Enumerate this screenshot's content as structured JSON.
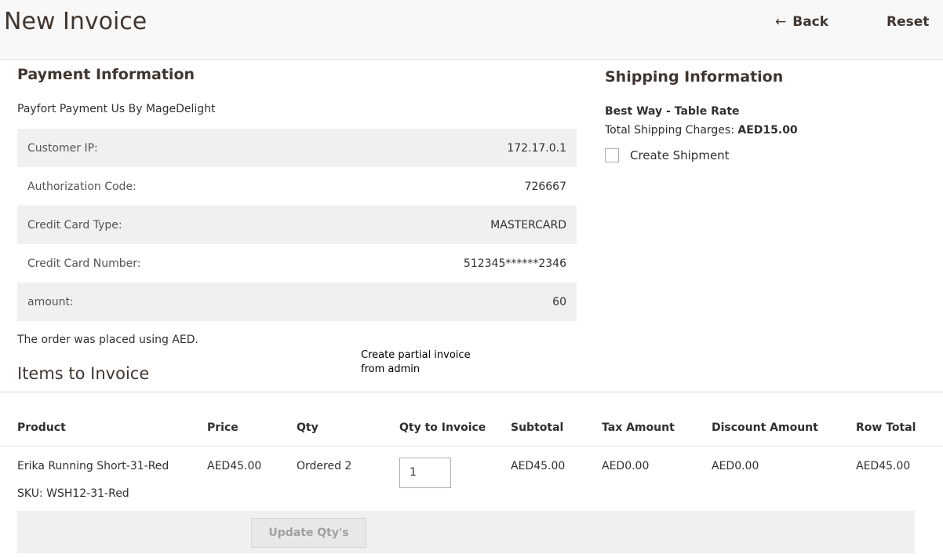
{
  "header": {
    "title": "New Invoice",
    "back_label": "Back",
    "back_arrow": "←",
    "reset_label": "Reset"
  },
  "payment": {
    "title": "Payment Information",
    "method": "Payfort Payment Us By MageDelight",
    "rows": [
      {
        "label": "Customer IP:",
        "value": "172.17.0.1"
      },
      {
        "label": "Authorization Code:",
        "value": "726667"
      },
      {
        "label": "Credit Card Type:",
        "value": "MASTERCARD"
      },
      {
        "label": "Credit Card Number:",
        "value": "512345******2346"
      },
      {
        "label": "amount:",
        "value": "60"
      }
    ],
    "currency_note": "The order was placed using AED."
  },
  "shipping": {
    "title": "Shipping Information",
    "method": "Best Way - Table Rate",
    "charges_label": "Total Shipping Charges: ",
    "charges_value": "AED15.00",
    "create_shipment_label": "Create Shipment",
    "create_shipment_checked": false
  },
  "annotation": {
    "line1": "Create partial invoice",
    "line2": "from admin"
  },
  "items": {
    "title": "Items to Invoice",
    "columns": [
      "Product",
      "Price",
      "Qty",
      "Qty to Invoice",
      "Subtotal",
      "Tax Amount",
      "Discount Amount",
      "Row Total"
    ],
    "rows": [
      {
        "product": "Erika Running Short-31-Red",
        "sku": "SKU: WSH12-31-Red",
        "price": "AED45.00",
        "qty": "Ordered 2",
        "qty_to_invoice": "1",
        "subtotal": "AED45.00",
        "tax": "AED0.00",
        "discount": "AED0.00",
        "row_total": "AED45.00"
      }
    ],
    "update_label": "Update Qty's"
  }
}
